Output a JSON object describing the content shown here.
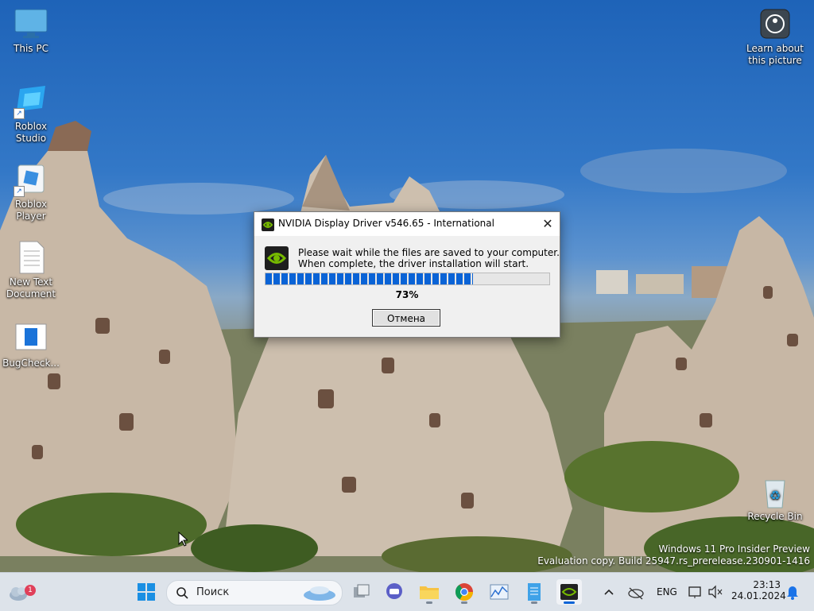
{
  "desktop": {
    "icons": [
      {
        "label": "This PC"
      },
      {
        "label": "Roblox Studio"
      },
      {
        "label": "Roblox Player"
      },
      {
        "label": "New Text Document"
      },
      {
        "label": "BugCheck..."
      },
      {
        "label": "Recycle Bin"
      }
    ],
    "spotlight": {
      "label": "Learn about this picture"
    },
    "watermark": {
      "line1": "Windows 11 Pro Insider Preview",
      "line2": "Evaluation copy. Build 25947.rs_prerelease.230901-1416"
    }
  },
  "dialog": {
    "title": "NVIDIA Display Driver v546.65 - International",
    "message_line1": "Please wait while the files are saved to your computer.",
    "message_line2": "When complete, the driver installation will start.",
    "progress_percent": 73,
    "progress_label": "73%",
    "cancel_label": "Отмена",
    "close_glyph": "✕"
  },
  "taskbar": {
    "weather_badge": "1",
    "search_placeholder": "Поиск",
    "apps": [
      "task-view",
      "teams-chat",
      "file-explorer",
      "chrome",
      "system-monitor",
      "notepad",
      "nvidia-installer"
    ],
    "active_app": "nvidia-installer",
    "language": "ENG",
    "time": "23:13",
    "date": "24.01.2024"
  },
  "colors": {
    "accent": "#0a63d6",
    "nvidia_green": "#76b900",
    "taskbar_bg": "#dde3ea"
  }
}
